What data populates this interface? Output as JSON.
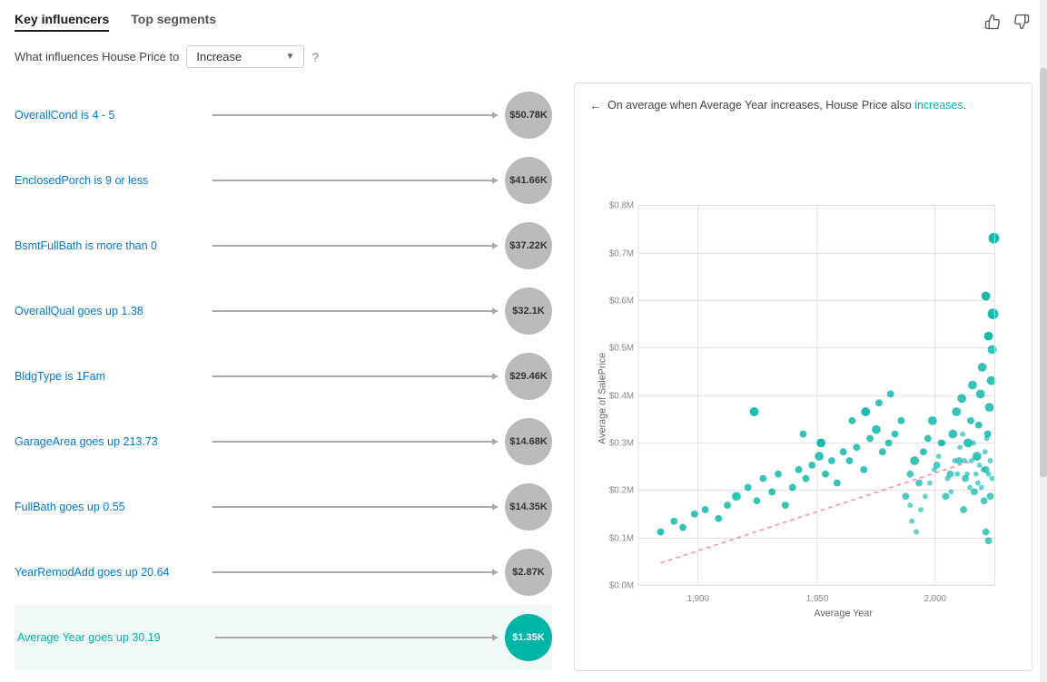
{
  "header": {
    "tab1": "Key influencers",
    "tab2": "Top segments",
    "active_tab": "tab1"
  },
  "subtitle": {
    "prefix": "What influences House Price to",
    "dropdown_value": "Increase",
    "help": "?"
  },
  "influencers": [
    {
      "id": 1,
      "label": "OverallCond is 4 - 5",
      "value": "$50.78K",
      "teal": false
    },
    {
      "id": 2,
      "label": "EnclosedPorch is 9 or less",
      "value": "$41.66K",
      "teal": false
    },
    {
      "id": 3,
      "label": "BsmtFullBath is more than 0",
      "value": "$37.22K",
      "teal": false
    },
    {
      "id": 4,
      "label": "OverallQual goes up 1.38",
      "value": "$32.1K",
      "teal": false
    },
    {
      "id": 5,
      "label": "BldgType is 1Fam",
      "value": "$29.46K",
      "teal": false
    },
    {
      "id": 6,
      "label": "GarageArea goes up 213.73",
      "value": "$14.68K",
      "teal": false
    },
    {
      "id": 7,
      "label": "FullBath goes up 0.55",
      "value": "$14.35K",
      "teal": false
    },
    {
      "id": 8,
      "label": "YearRemodAdd goes up 20.64",
      "value": "$2.87K",
      "teal": false
    },
    {
      "id": 9,
      "label": "Average Year goes up 30.19",
      "value": "$1.35K",
      "teal": true
    }
  ],
  "chart": {
    "back_arrow": "←",
    "description_pre": "On average when Average Year increases, House Price also",
    "description_highlight": "increases",
    "description_post": ".",
    "x_label": "Average Year",
    "y_label": "Average of SalePrice",
    "x_ticks": [
      "1,900",
      "1,950",
      "2,000"
    ],
    "y_ticks": [
      "$0.0M",
      "$0.1M",
      "$0.2M",
      "$0.3M",
      "$0.4M",
      "$0.5M",
      "$0.6M",
      "$0.7M",
      "$0.8M"
    ]
  }
}
